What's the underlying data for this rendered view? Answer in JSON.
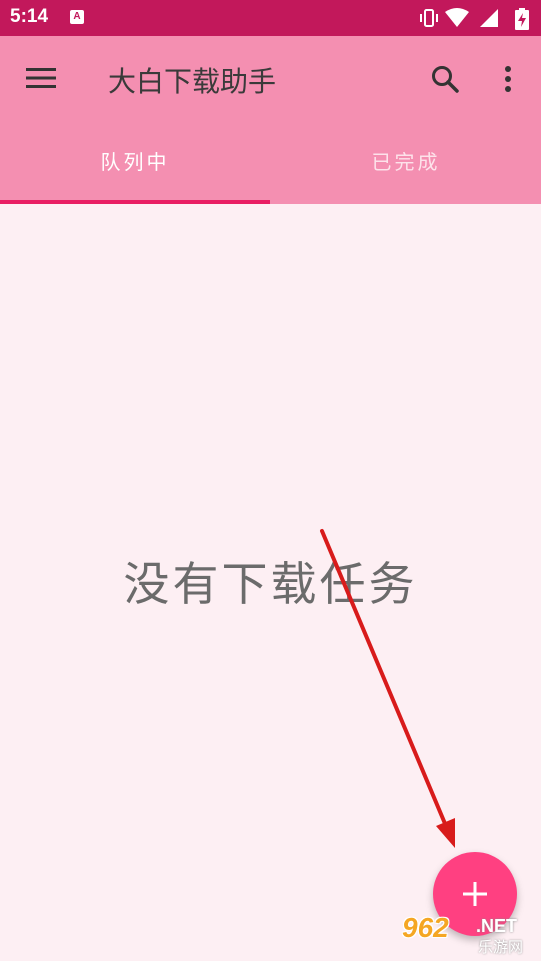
{
  "status_bar": {
    "time": "5:14",
    "notification_icon": "A",
    "icons": [
      "vibrate-icon",
      "wifi-icon",
      "signal-icon",
      "battery-charging-icon"
    ]
  },
  "app_bar": {
    "title": "大白下载助手",
    "menu_icon": "hamburger-menu-icon",
    "search_icon": "search-icon",
    "more_icon": "more-vert-icon"
  },
  "tabs": [
    {
      "label": "队列中",
      "selected": true
    },
    {
      "label": "已完成",
      "selected": false
    }
  ],
  "main": {
    "empty_message": "没有下载任务"
  },
  "fab": {
    "icon": "plus-icon"
  },
  "watermark": {
    "number": "962",
    "suffix": ".NET",
    "site": "乐游网"
  },
  "colors": {
    "status_bar": "#c2185b",
    "app_bar": "#f48fb1",
    "background": "#fdeff3",
    "accent": "#ff4081",
    "tab_indicator": "#e91e63",
    "annotation_arrow": "#d81b1b"
  }
}
